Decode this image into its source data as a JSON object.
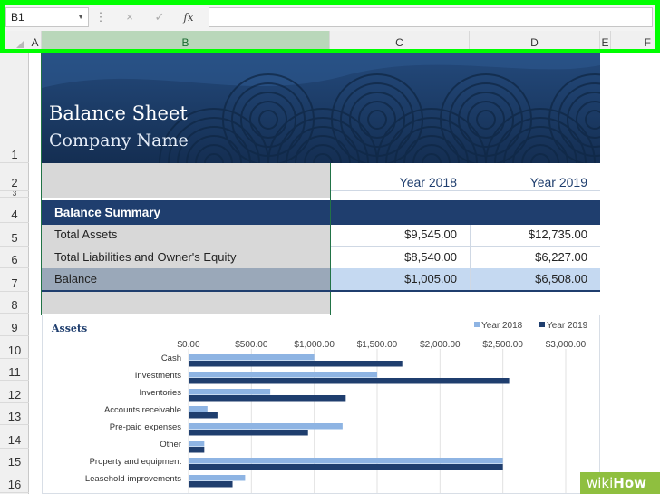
{
  "formula_bar": {
    "name_box": "B1",
    "cancel_icon": "×",
    "enter_icon": "✓",
    "fx_label": "fx",
    "formula_value": ""
  },
  "columns": [
    "A",
    "B",
    "C",
    "D",
    "E",
    "F"
  ],
  "rows": [
    "1",
    "2",
    "3",
    "4",
    "5",
    "6",
    "7",
    "8",
    "9",
    "10",
    "11",
    "12",
    "13",
    "14",
    "15",
    "16"
  ],
  "banner": {
    "title": "Balance Sheet",
    "subtitle": "Company Name"
  },
  "table": {
    "year_headers": [
      "Year 2018",
      "Year 2019"
    ],
    "section_title": "Balance Summary",
    "rows": [
      {
        "label": "Total Assets",
        "y2018": "$9,545.00",
        "y2019": "$12,735.00"
      },
      {
        "label": "Total Liabilities and Owner's Equity",
        "y2018": "$8,540.00",
        "y2019": "$6,227.00"
      },
      {
        "label": "Balance",
        "y2018": "$1,005.00",
        "y2019": "$6,508.00"
      }
    ]
  },
  "chart_data": {
    "type": "bar",
    "orientation": "horizontal",
    "title": "Assets",
    "categories": [
      "Cash",
      "Investments",
      "Inventories",
      "Accounts receivable",
      "Pre-paid expenses",
      "Other",
      "Property and equipment",
      "Leasehold improvements"
    ],
    "series": [
      {
        "name": "Year 2018",
        "color": "#8eb4e3",
        "values": [
          1000,
          1500,
          650,
          150,
          1225,
          125,
          2500,
          450
        ]
      },
      {
        "name": "Year 2019",
        "color": "#1f3e6e",
        "values": [
          1700,
          2550,
          1250,
          230,
          950,
          125,
          2500,
          350
        ]
      }
    ],
    "x_ticks": [
      "$0.00",
      "$500.00",
      "$1,000.00",
      "$1,500.00",
      "$2,000.00",
      "$2,500.00",
      "$3,000.00"
    ],
    "xlim": [
      0,
      3000
    ],
    "legend": "top-right",
    "grid": true
  },
  "colors": {
    "navy": "#1f3e6e",
    "excel_green": "#217346",
    "highlight": "#00ff00"
  },
  "watermark": {
    "prefix": "wiki",
    "suffix": "How"
  }
}
